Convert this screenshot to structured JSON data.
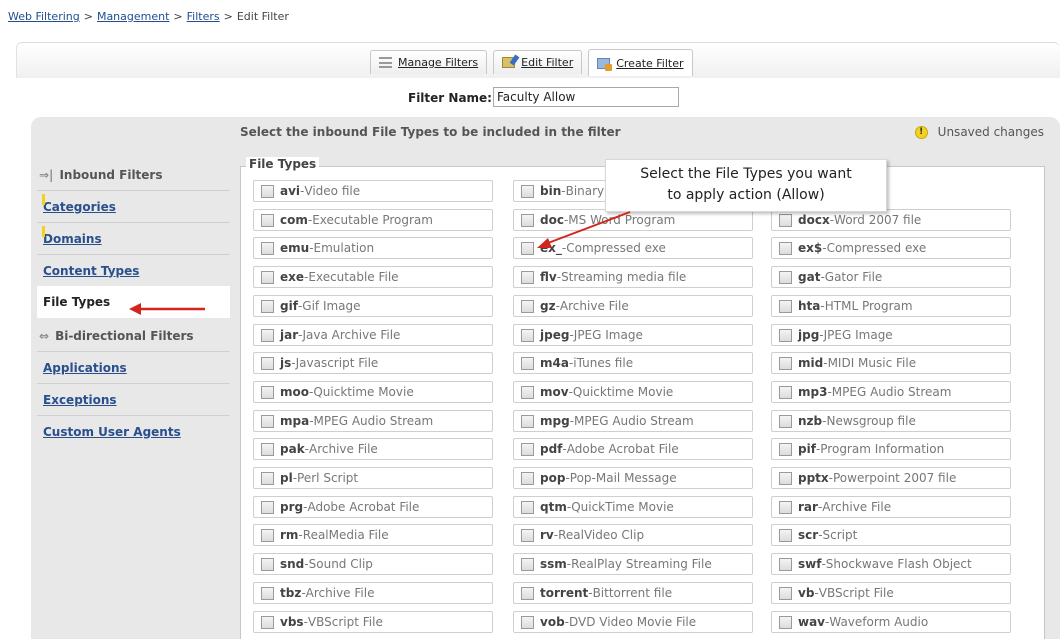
{
  "breadcrumb": {
    "items": [
      "Web Filtering",
      "Management",
      "Filters"
    ],
    "current": "Edit Filter",
    "separator": ">"
  },
  "tabs": [
    {
      "label": "Manage Filters",
      "icon": "list-icon"
    },
    {
      "label": "Edit Filter",
      "icon": "edit-icon"
    },
    {
      "label": "Create Filter",
      "icon": "create-icon"
    }
  ],
  "filter_name": {
    "label": "Filter Name:",
    "value": "Faculty Allow"
  },
  "header": {
    "instruction": "Select the inbound File Types to be included in the filter",
    "warn_symbol": "!",
    "unsaved": "Unsaved changes"
  },
  "sidebar": {
    "inbound_heading": "Inbound Filters",
    "inbound_items": [
      {
        "label": "Categories",
        "flagged": true
      },
      {
        "label": "Domains",
        "flagged": true
      },
      {
        "label": "Content Types",
        "flagged": false
      },
      {
        "label": "File Types",
        "flagged": false,
        "selected": true
      }
    ],
    "bidir_heading": "Bi-directional Filters",
    "bidir_items": [
      {
        "label": "Applications"
      },
      {
        "label": "Exceptions"
      },
      {
        "label": "Custom User Agents"
      }
    ]
  },
  "file_types": {
    "legend": "File Types",
    "rows": [
      [
        [
          "avi",
          "Video file"
        ],
        [
          "bin",
          "Binary"
        ],
        [
          "",
          ""
        ]
      ],
      [
        [
          "com",
          "Executable Program"
        ],
        [
          "doc",
          "MS Word Program"
        ],
        [
          "docx",
          "Word 2007 file"
        ]
      ],
      [
        [
          "emu",
          "Emulation"
        ],
        [
          "ex_",
          "Compressed exe"
        ],
        [
          "ex$",
          "Compressed exe"
        ]
      ],
      [
        [
          "exe",
          "Executable File"
        ],
        [
          "flv",
          "Streaming media file"
        ],
        [
          "gat",
          "Gator File"
        ]
      ],
      [
        [
          "gif",
          "Gif Image"
        ],
        [
          "gz",
          "Archive File"
        ],
        [
          "hta",
          "HTML Program"
        ]
      ],
      [
        [
          "jar",
          "Java Archive File"
        ],
        [
          "jpeg",
          "JPEG Image"
        ],
        [
          "jpg",
          "JPEG Image"
        ]
      ],
      [
        [
          "js",
          "Javascript File"
        ],
        [
          "m4a",
          "iTunes file"
        ],
        [
          "mid",
          "MIDI Music File"
        ]
      ],
      [
        [
          "moo",
          "Quicktime Movie"
        ],
        [
          "mov",
          "Quicktime Movie"
        ],
        [
          "mp3",
          "MPEG Audio Stream"
        ]
      ],
      [
        [
          "mpa",
          "MPEG Audio Stream"
        ],
        [
          "mpg",
          "MPEG Audio Stream"
        ],
        [
          "nzb",
          "Newsgroup file"
        ]
      ],
      [
        [
          "pak",
          "Archive File"
        ],
        [
          "pdf",
          "Adobe Acrobat File"
        ],
        [
          "pif",
          "Program Information"
        ]
      ],
      [
        [
          "pl",
          "Perl Script"
        ],
        [
          "pop",
          "Pop-Mail Message"
        ],
        [
          "pptx",
          "Powerpoint 2007 file"
        ]
      ],
      [
        [
          "prg",
          "Adobe Acrobat File"
        ],
        [
          "qtm",
          "QuickTime Movie"
        ],
        [
          "rar",
          "Archive File"
        ]
      ],
      [
        [
          "rm",
          "RealMedia File"
        ],
        [
          "rv",
          "RealVideo Clip"
        ],
        [
          "scr",
          "Script"
        ]
      ],
      [
        [
          "snd",
          "Sound Clip"
        ],
        [
          "ssm",
          "RealPlay Streaming File"
        ],
        [
          "swf",
          "Shockwave Flash Object"
        ]
      ],
      [
        [
          "tbz",
          "Archive File"
        ],
        [
          "torrent",
          "Bittorrent file"
        ],
        [
          "vb",
          "VBScript File"
        ]
      ],
      [
        [
          "vbs",
          "VBScript File"
        ],
        [
          "vob",
          "DVD Video Movie File"
        ],
        [
          "wav",
          "Waveform Audio"
        ]
      ]
    ]
  },
  "callout": {
    "line1": "Select the File Types you want",
    "line2": "to apply action (Allow)"
  },
  "colors": {
    "annotation_arrow": "#d0261d",
    "link": "#2a4f8d",
    "warning": "#f1d21e"
  }
}
